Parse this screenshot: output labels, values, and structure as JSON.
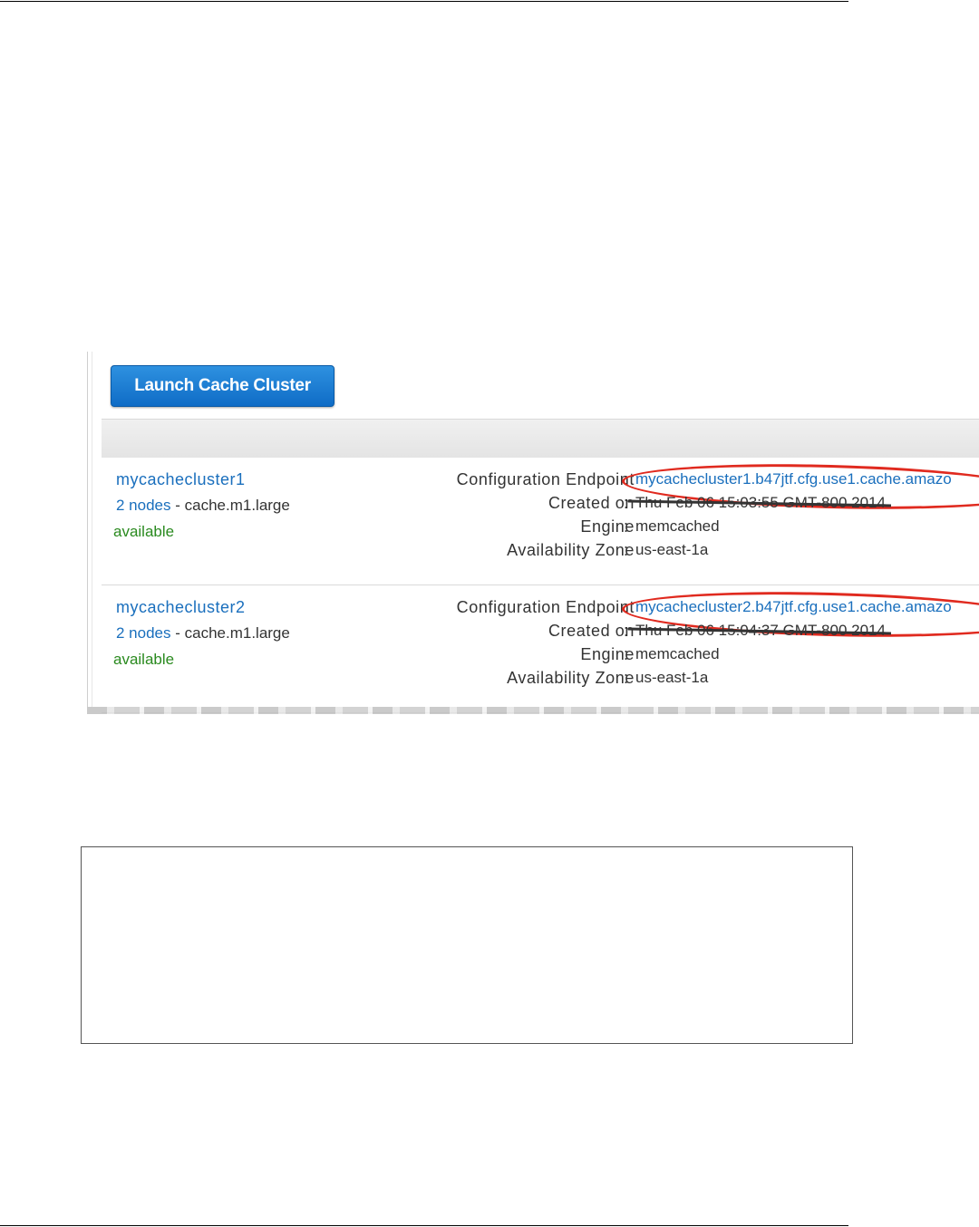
{
  "toolbar": {
    "launch_label": "Launch Cache Cluster"
  },
  "labels": {
    "config_endpoint": "Configuration Endpoint",
    "created_on": "Created on",
    "engine": "Engine",
    "availability_zone": "Availability Zone"
  },
  "clusters": [
    {
      "name": "mycachecluster1",
      "nodes_link": "2 nodes",
      "node_type": "- cache.m1.large",
      "status": "available",
      "endpoint": "mycachecluster1.b47jtf.cfg.use1.cache.amazo",
      "created_on": "Thu Feb 06 15:03:55 GMT-800 2014",
      "engine": "memcached",
      "availability_zone": "us-east-1a"
    },
    {
      "name": "mycachecluster2",
      "nodes_link": "2 nodes",
      "node_type": "- cache.m1.large",
      "status": "available",
      "endpoint": "mycachecluster2.b47jtf.cfg.use1.cache.amazo",
      "created_on": "Thu Feb 06 15:04:37 GMT-800 2014",
      "engine": "memcached",
      "availability_zone": "us-east-1a"
    }
  ],
  "colors": {
    "link": "#1a6fbd",
    "status_available": "#2a8a1f",
    "annotation": "#e02a1f",
    "button": "#0f6cc6"
  }
}
